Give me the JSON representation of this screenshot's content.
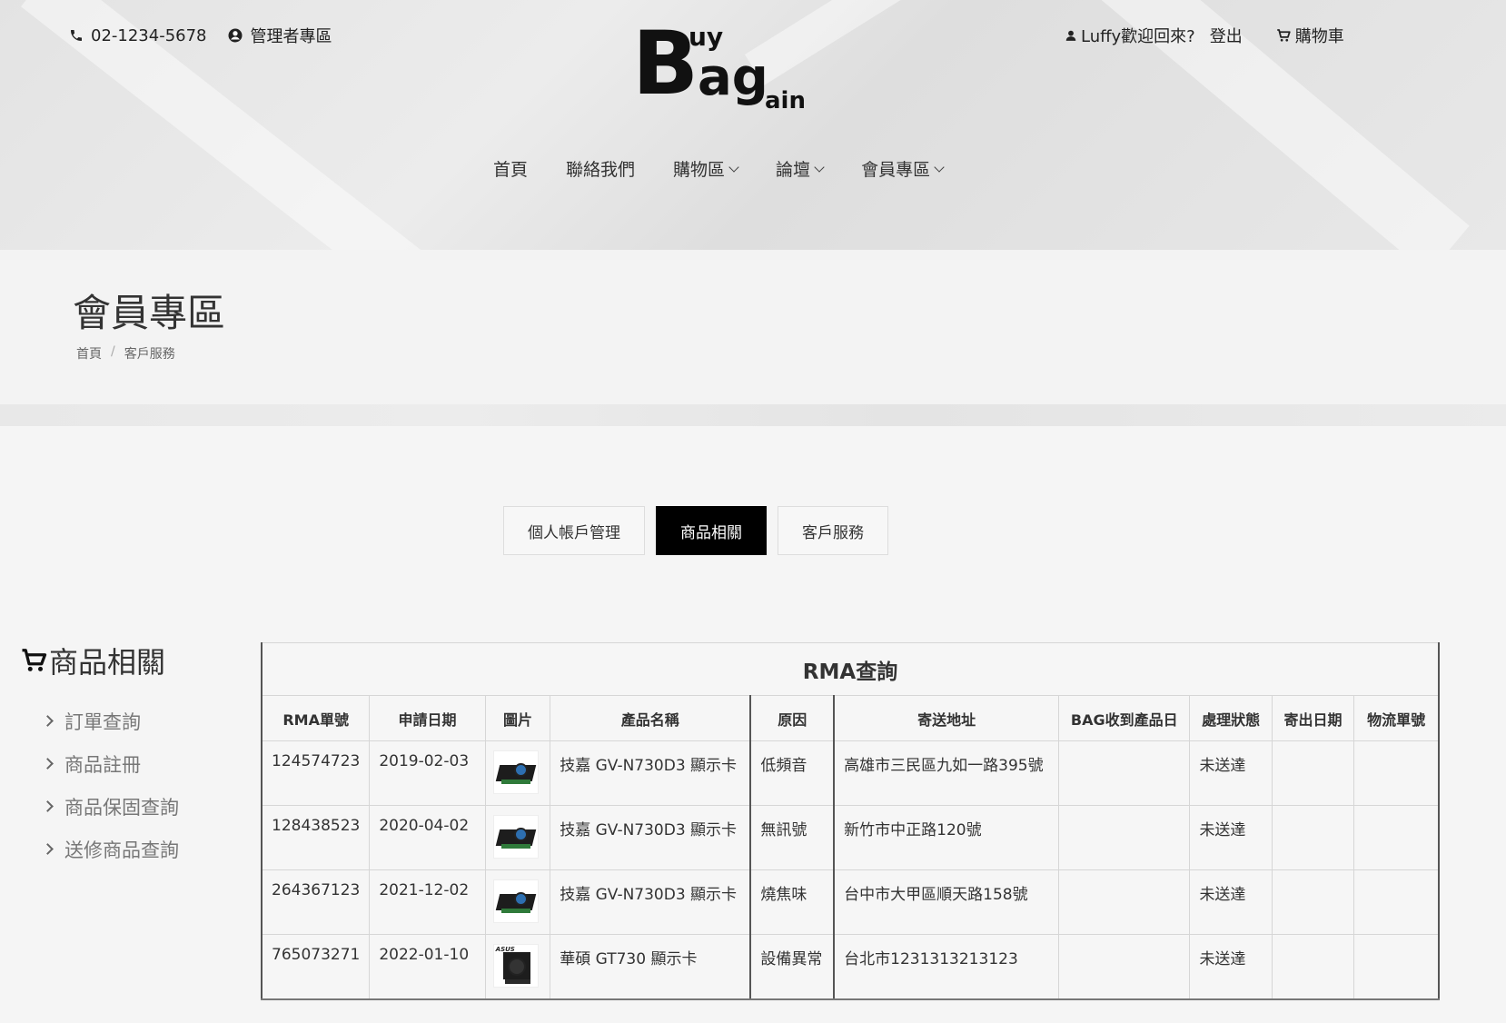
{
  "header": {
    "phone": "02-1234-5678",
    "admin_link": "管理者專區",
    "welcome": "Luffy歡迎回來?",
    "logout": "登出",
    "cart": "購物車",
    "logo": {
      "b": "B",
      "uy": "uy",
      "ag": "ag",
      "ain": "ain"
    }
  },
  "nav": {
    "items": [
      {
        "label": "首頁",
        "dropdown": false
      },
      {
        "label": "聯絡我們",
        "dropdown": false
      },
      {
        "label": "購物區",
        "dropdown": true
      },
      {
        "label": "論壇",
        "dropdown": true
      },
      {
        "label": "會員專區",
        "dropdown": true
      }
    ]
  },
  "page": {
    "title": "會員專區",
    "breadcrumb": {
      "home": "首頁",
      "separator": "/",
      "current": "客戶服務"
    }
  },
  "tabs": [
    {
      "label": "個人帳戶管理",
      "active": false
    },
    {
      "label": "商品相關",
      "active": true
    },
    {
      "label": "客戶服務",
      "active": false
    }
  ],
  "sidebar": {
    "title": "商品相關",
    "items": [
      {
        "label": "訂單查詢"
      },
      {
        "label": "商品註冊"
      },
      {
        "label": "商品保固查詢"
      },
      {
        "label": "送修商品查詢"
      }
    ]
  },
  "table": {
    "caption": "RMA查詢",
    "headers": [
      "RMA單號",
      "申請日期",
      "圖片",
      "產品名稱",
      "原因",
      "寄送地址",
      "BAG收到產品日",
      "處理狀態",
      "寄出日期",
      "物流單號"
    ],
    "rows": [
      {
        "rma": "124574723",
        "date": "2019-02-03",
        "image": "gpu-image",
        "product": "技嘉 GV-N730D3 顯示卡",
        "reason": "低頻音",
        "address": "高雄市三民區九如一路395號",
        "received": "",
        "status": "未送達",
        "shipped": "",
        "tracking": ""
      },
      {
        "rma": "128438523",
        "date": "2020-04-02",
        "image": "gpu-image",
        "product": "技嘉 GV-N730D3 顯示卡",
        "reason": "無訊號",
        "address": "新竹市中正路120號",
        "received": "",
        "status": "未送達",
        "shipped": "",
        "tracking": ""
      },
      {
        "rma": "264367123",
        "date": "2021-12-02",
        "image": "gpu-image",
        "product": "技嘉 GV-N730D3 顯示卡",
        "reason": "燒焦味",
        "address": "台中市大甲區順天路158號",
        "received": "",
        "status": "未送達",
        "shipped": "",
        "tracking": ""
      },
      {
        "rma": "765073271",
        "date": "2022-01-10",
        "image": "asus-gpu-image",
        "product": "華碩 GT730 顯示卡",
        "reason": "設備異常",
        "address": "台北市1231313213123",
        "received": "",
        "status": "未送達",
        "shipped": "",
        "tracking": ""
      }
    ]
  },
  "colors": {
    "active_tab": "#000000",
    "background": "#f5f5f5",
    "text": "#333333"
  }
}
